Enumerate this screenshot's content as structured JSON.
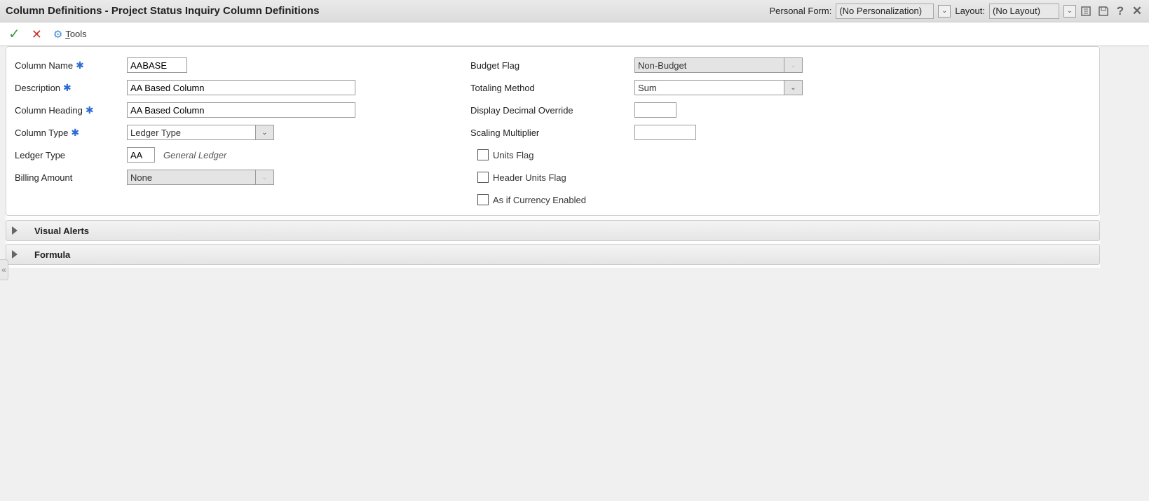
{
  "header": {
    "title": "Column Definitions - Project Status Inquiry Column Definitions",
    "personal_form_label": "Personal Form:",
    "personal_form_value": "(No Personalization)",
    "layout_label": "Layout:",
    "layout_value": "(No Layout)"
  },
  "toolbar": {
    "tools_label": "Tools"
  },
  "form": {
    "column_name_label": "Column Name",
    "column_name_value": "AABASE",
    "description_label": "Description",
    "description_value": "AA Based Column",
    "column_heading_label": "Column Heading",
    "column_heading_value": "AA Based Column",
    "column_type_label": "Column Type",
    "column_type_value": "Ledger Type",
    "ledger_type_label": "Ledger Type",
    "ledger_type_value": "AA",
    "ledger_type_hint": "General Ledger",
    "billing_amount_label": "Billing Amount",
    "billing_amount_value": "None",
    "budget_flag_label": "Budget Flag",
    "budget_flag_value": "Non-Budget",
    "totaling_method_label": "Totaling Method",
    "totaling_method_value": "Sum",
    "display_decimal_label": "Display Decimal Override",
    "display_decimal_value": "",
    "scaling_multiplier_label": "Scaling Multiplier",
    "scaling_multiplier_value": "",
    "units_flag_label": "Units Flag",
    "header_units_flag_label": "Header Units Flag",
    "as_if_currency_label": "As if Currency Enabled"
  },
  "accordions": {
    "visual_alerts": "Visual Alerts",
    "formula": "Formula"
  }
}
